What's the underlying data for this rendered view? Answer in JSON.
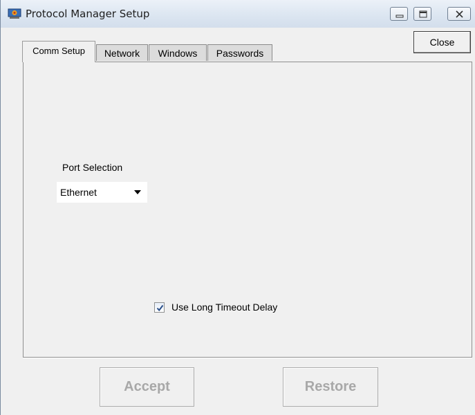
{
  "window": {
    "title": "Protocol Manager Setup",
    "app_icon": "protocol-manager-icon",
    "caption_buttons": [
      "minimize-icon",
      "maximize-icon",
      "close-icon"
    ]
  },
  "toolbar": {
    "close_label": "Close"
  },
  "tabs": [
    {
      "label": "Comm Setup",
      "active": true
    },
    {
      "label": "Network",
      "active": false
    },
    {
      "label": "Windows",
      "active": false
    },
    {
      "label": "Passwords",
      "active": false
    }
  ],
  "comm_setup": {
    "port_selection_label": "Port Selection",
    "port_selection_value": "Ethernet",
    "long_timeout": {
      "label": "Use Long Timeout Delay",
      "checked": true
    }
  },
  "actions": {
    "accept_label": "Accept",
    "restore_label": "Restore",
    "disabled": true
  },
  "colors": {
    "window_bg": "#f0f0f0",
    "disabled_text": "#a8a8a8",
    "titlebar": "#dce6f1",
    "check_mark": "#2a4f8a"
  }
}
